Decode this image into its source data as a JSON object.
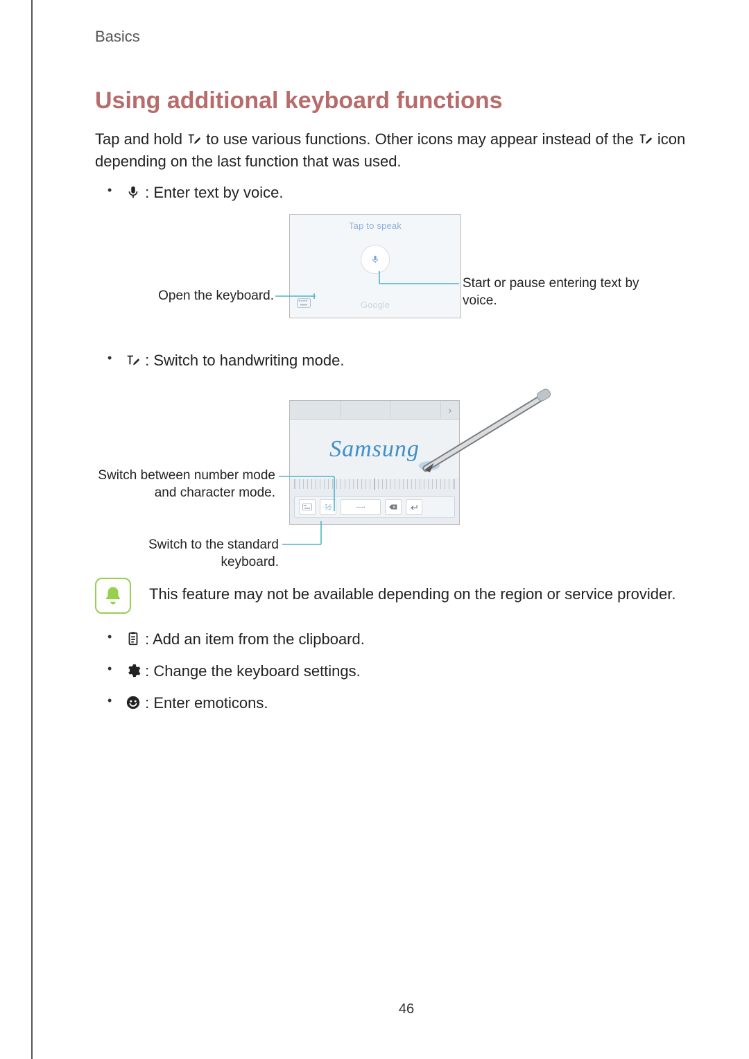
{
  "header": {
    "section": "Basics"
  },
  "title": "Using additional keyboard functions",
  "intro": {
    "part1": "Tap and hold ",
    "part2": " to use various functions. Other icons may appear instead of the ",
    "part3": " icon depending on the last function that was used."
  },
  "bullets": {
    "voice": ": Enter text by voice.",
    "handwriting": ": Switch to handwriting mode.",
    "clipboard": ": Add an item from the clipboard.",
    "settings": ": Change the keyboard settings.",
    "emoticons": ": Enter emoticons."
  },
  "figure1": {
    "tap_to_speak": "Tap to speak",
    "google": "Google",
    "callout_left": "Open the keyboard.",
    "callout_right": "Start or pause entering text by voice."
  },
  "figure2": {
    "sample_text": "Samsung",
    "callout_left_top": "Switch between number mode and character mode.",
    "callout_left_bottom": "Switch to the standard keyboard."
  },
  "note": "This feature may not be available depending on the region or service provider.",
  "page_number": "46"
}
